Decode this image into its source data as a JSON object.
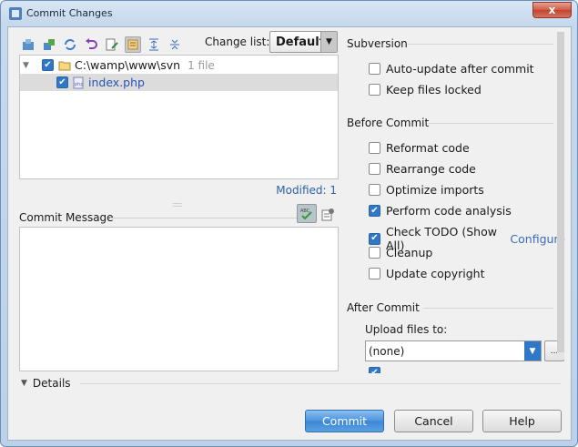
{
  "window": {
    "title": "Commit Changes",
    "close_label": "x"
  },
  "toolbar": {
    "icons": [
      "commit-icon",
      "branch-icon",
      "refresh-icon",
      "rollback-icon",
      "edit-icon",
      "group-icon",
      "expand-all-icon",
      "collapse-all-icon"
    ]
  },
  "changelist": {
    "label": "Change list:",
    "value": "Default"
  },
  "tree": {
    "root": {
      "path": "C:\\wamp\\www\\svn",
      "count": "1 file"
    },
    "files": [
      {
        "name": "index.php"
      }
    ]
  },
  "status": {
    "modified": "Modified: 1"
  },
  "commit_message": {
    "label": "Commit Message",
    "value": ""
  },
  "details": {
    "label": "Details"
  },
  "subversion": {
    "heading": "Subversion",
    "options": [
      {
        "label": "Auto-update after commit",
        "checked": false
      },
      {
        "label": "Keep files locked",
        "checked": false
      }
    ]
  },
  "before_commit": {
    "heading": "Before Commit",
    "options": [
      {
        "label": "Reformat code",
        "checked": false
      },
      {
        "label": "Rearrange code",
        "checked": false
      },
      {
        "label": "Optimize imports",
        "checked": false
      },
      {
        "label": "Perform code analysis",
        "checked": true
      },
      {
        "label": "Check TODO (Show All)",
        "checked": true,
        "link": "Configure"
      },
      {
        "label": "Cleanup",
        "checked": false
      },
      {
        "label": "Update copyright",
        "checked": false
      }
    ]
  },
  "after_commit": {
    "heading": "After Commit",
    "upload_label": "Upload files to:",
    "upload_value": "(none)",
    "more_label": "..."
  },
  "buttons": {
    "commit": "Commit",
    "cancel": "Cancel",
    "help": "Help"
  }
}
